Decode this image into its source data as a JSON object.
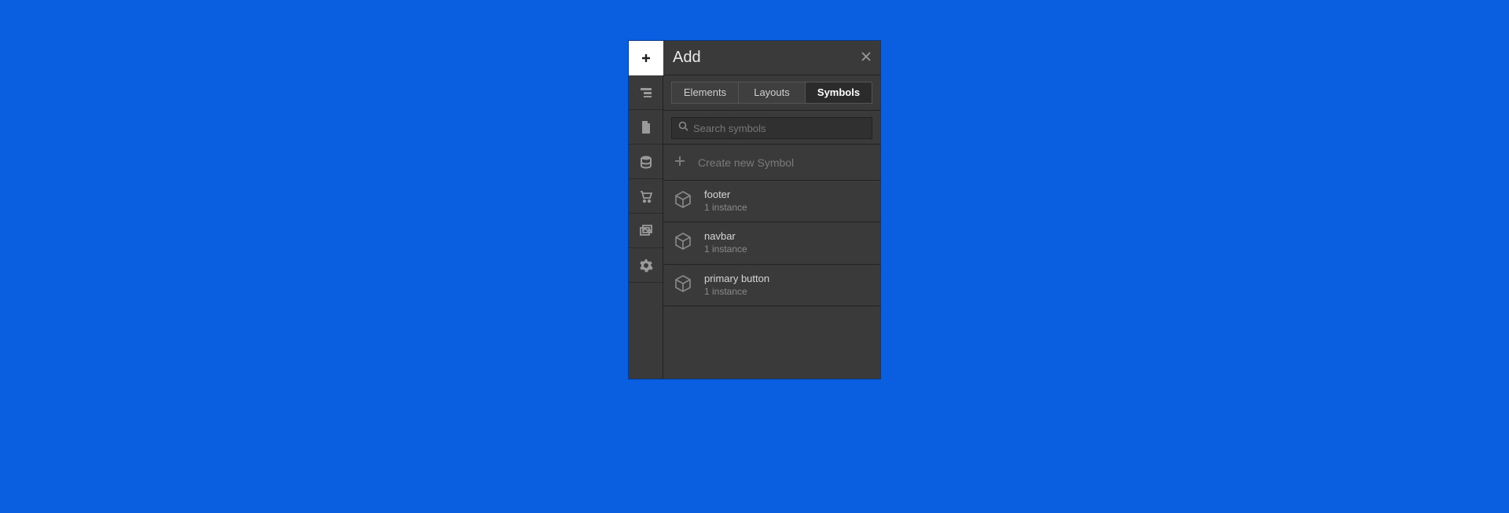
{
  "panel": {
    "title": "Add"
  },
  "tabs": [
    {
      "label": "Elements",
      "active": false
    },
    {
      "label": "Layouts",
      "active": false
    },
    {
      "label": "Symbols",
      "active": true
    }
  ],
  "search": {
    "placeholder": "Search symbols"
  },
  "create": {
    "label": "Create new Symbol"
  },
  "symbols": [
    {
      "name": "footer",
      "meta": "1 instance"
    },
    {
      "name": "navbar",
      "meta": "1 instance"
    },
    {
      "name": "primary button",
      "meta": "1 instance"
    }
  ],
  "iconbar": [
    {
      "name": "add",
      "active": true
    },
    {
      "name": "navigator",
      "active": false
    },
    {
      "name": "pages",
      "active": false
    },
    {
      "name": "cms",
      "active": false
    },
    {
      "name": "ecommerce",
      "active": false
    },
    {
      "name": "assets",
      "active": false
    },
    {
      "name": "settings",
      "active": false
    }
  ]
}
